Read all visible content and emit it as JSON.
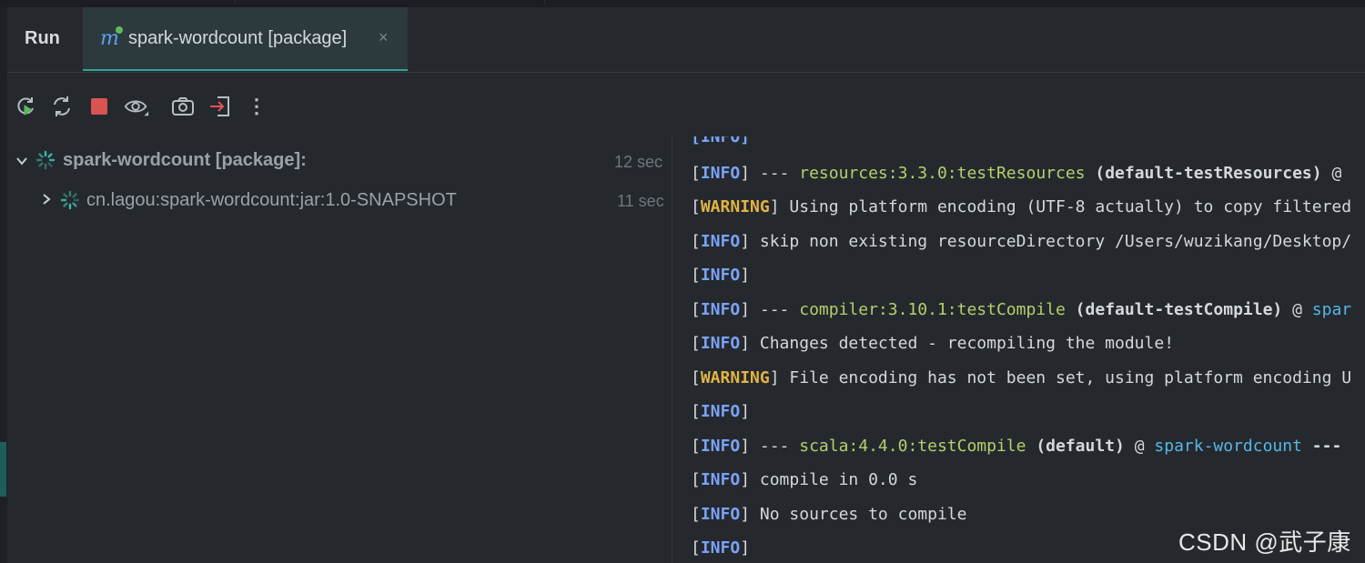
{
  "header": {
    "run_label": "Run",
    "tab": {
      "label": "spark-wordcount [package]",
      "close_symbol": "×",
      "icon": "maven-run-icon"
    }
  },
  "toolbar": {
    "buttons": [
      {
        "name": "rerun-icon"
      },
      {
        "name": "rerun-failed-icon"
      },
      {
        "name": "stop-icon"
      },
      {
        "name": "show-icon"
      },
      {
        "name": "screenshot-icon"
      },
      {
        "name": "exit-icon"
      },
      {
        "name": "more-icon",
        "glyph": "⋮"
      }
    ]
  },
  "tree": {
    "items": [
      {
        "label": "spark-wordcount [package]:",
        "time": "12 sec",
        "expanded": true
      },
      {
        "label": "cn.lagou:spark-wordcount:jar:1.0-SNAPSHOT",
        "time": "11 sec",
        "expanded": false
      }
    ]
  },
  "console": {
    "partial_top": "[INFO]",
    "lines": [
      {
        "level": "INFO",
        "prefix": " --- ",
        "plugin": "resources:3.3.0:testResources",
        "exec": " (default-testResources) ",
        "at": "@"
      },
      {
        "level": "WARNING",
        "text": " Using platform encoding (UTF-8 actually) to copy filtered"
      },
      {
        "level": "INFO",
        "text": " skip non existing resourceDirectory /Users/wuzikang/Desktop/"
      },
      {
        "level": "INFO",
        "text": ""
      },
      {
        "level": "INFO",
        "prefix": " --- ",
        "plugin": "compiler:3.10.1:testCompile",
        "exec": " (default-testCompile) ",
        "at": "@ ",
        "project": "spar"
      },
      {
        "level": "INFO",
        "text": " Changes detected - recompiling the module!"
      },
      {
        "level": "WARNING",
        "text": " File encoding has not been set, using platform encoding U"
      },
      {
        "level": "INFO",
        "text": ""
      },
      {
        "level": "INFO",
        "prefix": " --- ",
        "plugin": "scala:4.4.0:testCompile",
        "exec": " (default) ",
        "at": "@ ",
        "project": "spark-wordcount",
        "suffix": " ---"
      },
      {
        "level": "INFO",
        "text": " compile in 0.0 s"
      },
      {
        "level": "INFO",
        "text": " No sources to compile"
      },
      {
        "level": "INFO",
        "text": ""
      }
    ]
  },
  "watermark": "CSDN @武子康",
  "colors": {
    "panel_bg": "#25292e",
    "tab_active_bg": "#2c3a3e",
    "tab_underline": "#2ea59a",
    "info": "#7aa2f7",
    "warning": "#e3b341",
    "plugin": "#b5cf6b",
    "project": "#58b6e6",
    "stop": "#d9534f"
  }
}
